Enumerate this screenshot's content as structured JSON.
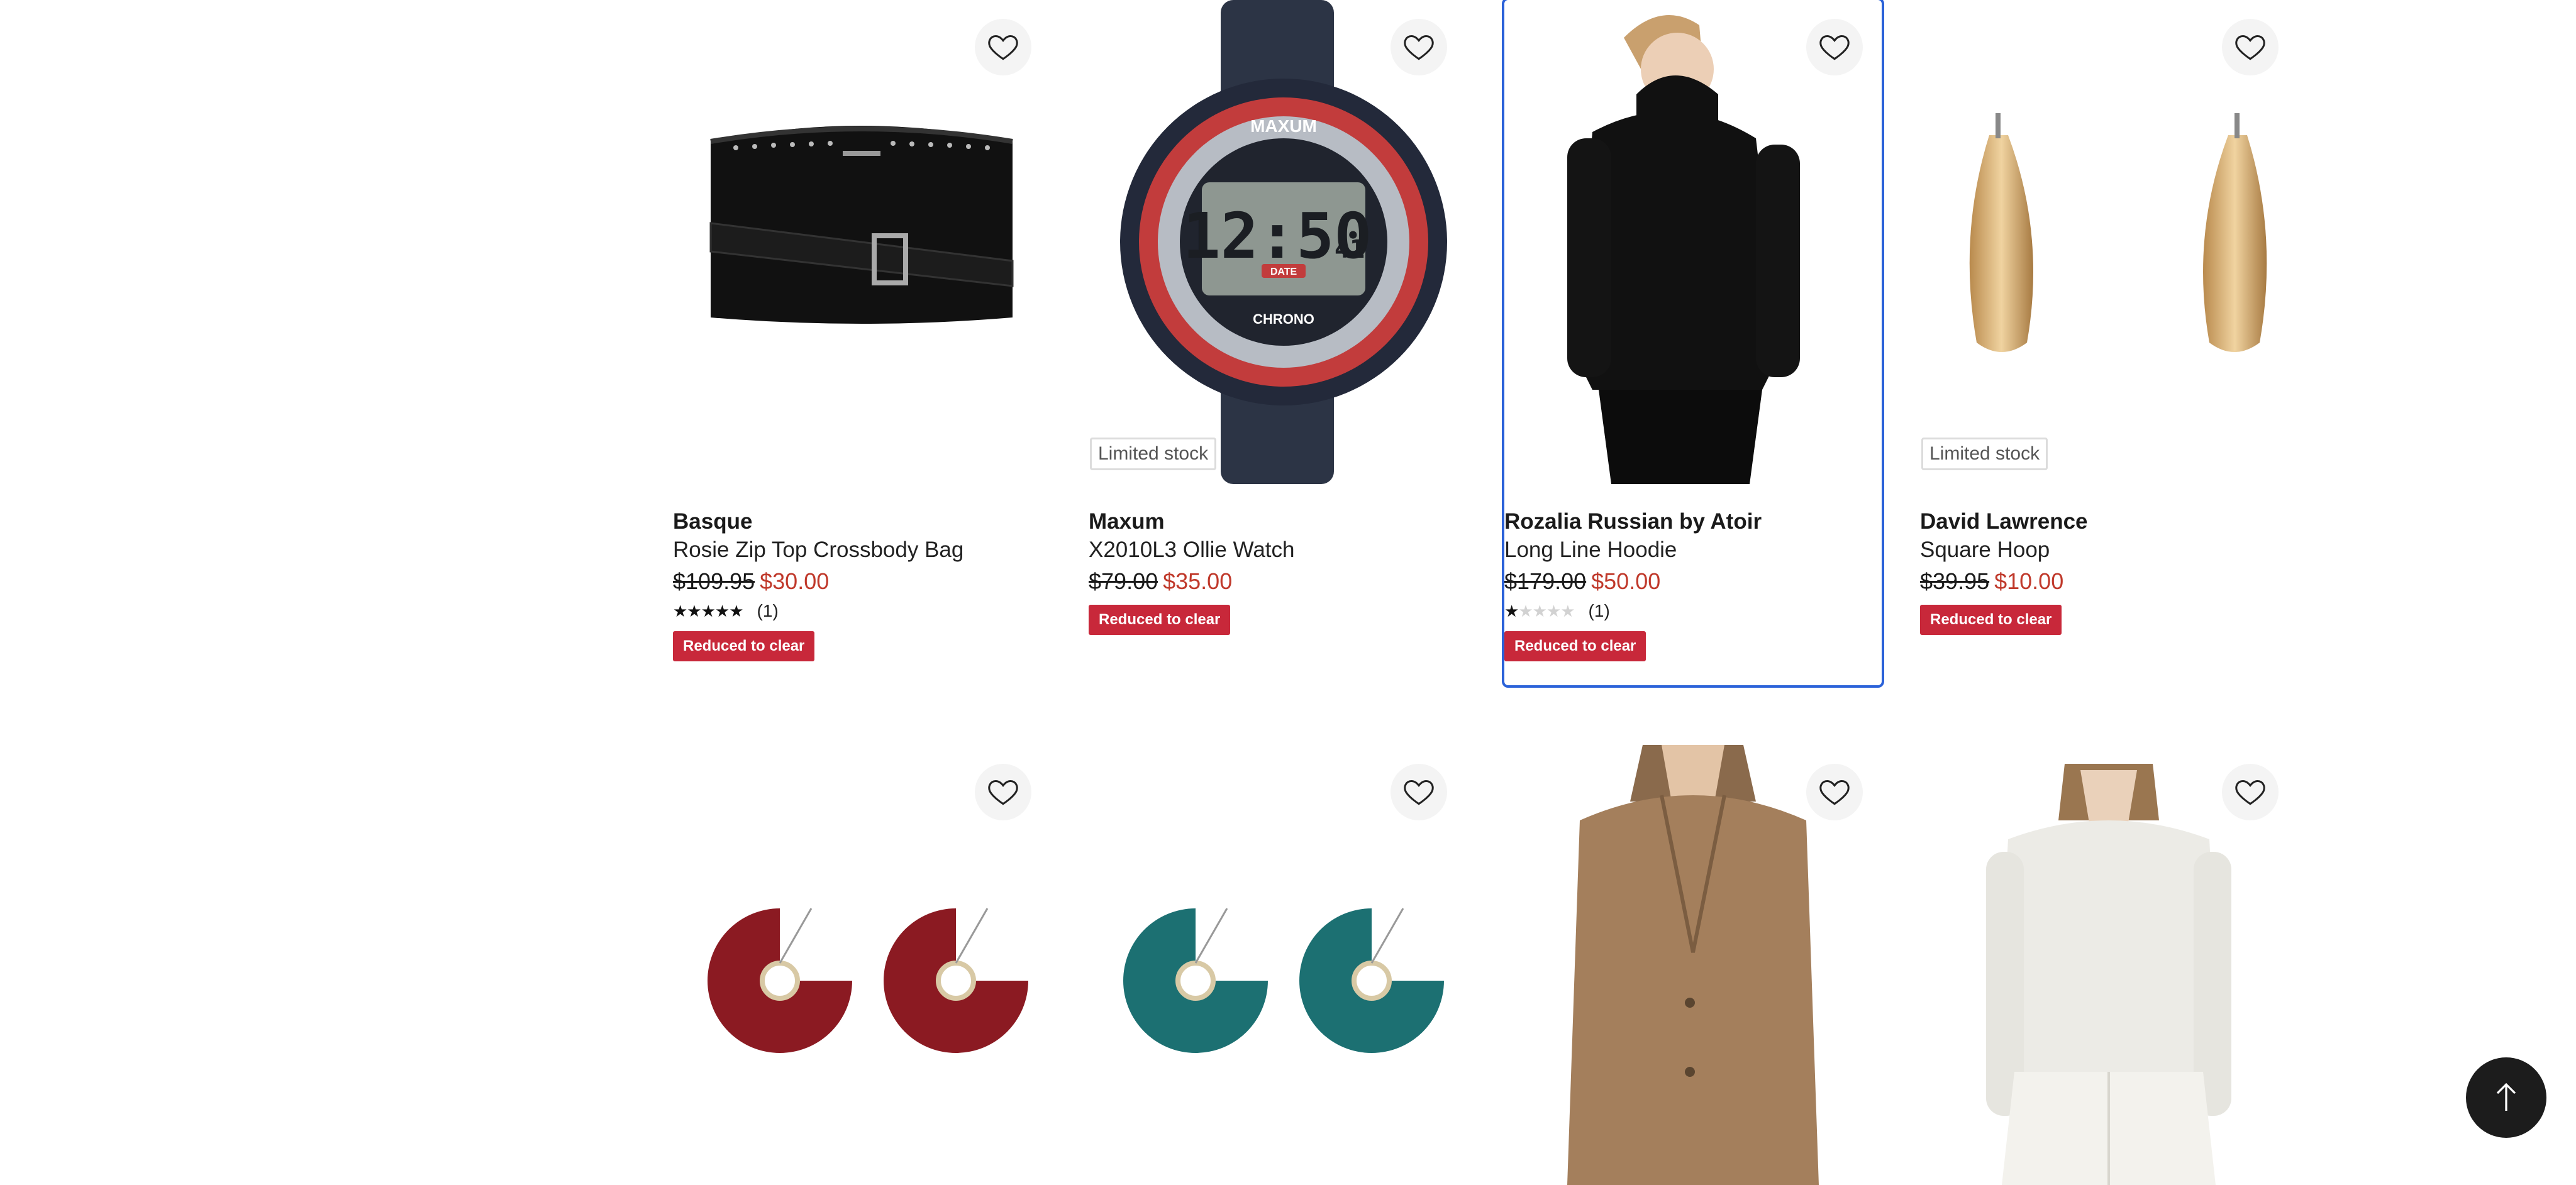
{
  "products": [
    {
      "brand": "Basque",
      "name": "Rosie Zip Top Crossbody Bag",
      "was_price": "$109.95",
      "now_price": "$30.00",
      "rating_stars": 5,
      "rating_count": "(1)",
      "promo": "Reduced to clear",
      "image_icon": "crossbody-bag-image"
    },
    {
      "brand": "Maxum",
      "name": "X2010L3 Ollie Watch",
      "was_price": "$79.00",
      "now_price": "$35.00",
      "stock_badge": "Limited stock",
      "promo": "Reduced to clear",
      "image_icon": "digital-watch-image",
      "watch_brand": "MAXUM",
      "watch_time": "12:50",
      "watch_seconds": "41",
      "watch_label": "CHRONO",
      "watch_date_label": "DATE"
    },
    {
      "brand": "Rozalia Russian by Atoir",
      "name": "Long Line Hoodie",
      "was_price": "$179.00",
      "now_price": "$50.00",
      "rating_stars": 1,
      "rating_count": "(1)",
      "promo": "Reduced to clear",
      "selected": true,
      "image_icon": "hoodie-model-image"
    },
    {
      "brand": "David Lawrence",
      "name": "Square Hoop",
      "was_price": "$39.95",
      "now_price": "$10.00",
      "stock_badge": "Limited stock",
      "promo": "Reduced to clear",
      "image_icon": "gold-hoop-earrings-image"
    }
  ],
  "row2": [
    {
      "image_icon": "red-disc-earrings-image"
    },
    {
      "image_icon": "teal-disc-earrings-image"
    },
    {
      "image_icon": "tan-blazer-model-image"
    },
    {
      "image_icon": "white-knit-model-image"
    }
  ],
  "colors": {
    "sale_red": "#c0392b",
    "promo_red": "#c8283a",
    "selected_outline": "#2b62d9"
  }
}
